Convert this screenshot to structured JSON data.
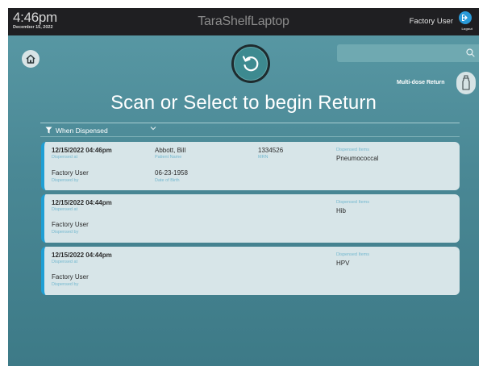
{
  "header": {
    "time": "4:46pm",
    "date": "December 15, 2022",
    "app_name": "TaraShelfLaptop",
    "user": "Factory User",
    "logout_label": "Logout"
  },
  "main": {
    "title": "Scan or Select to begin Return",
    "multidose_label": "Multi-dose Return",
    "search_placeholder": ""
  },
  "filter": {
    "label": "When Dispensed"
  },
  "labels": {
    "dispensed_at": "Dispensed at",
    "dispensed_by": "Dispensed by",
    "patient_name": "Patient Name",
    "date_of_birth": "Date of Birth",
    "mrn": "MRN",
    "dispensed_items": "Dispensed Items"
  },
  "records": [
    {
      "dispensed_at": "12/15/2022  04:46pm",
      "dispensed_by": "Factory User",
      "patient_name": "Abbott, Bill",
      "date_of_birth": "06-23-1958",
      "mrn": "1334526",
      "items": "Pneumococcal"
    },
    {
      "dispensed_at": "12/15/2022  04:44pm",
      "dispensed_by": "Factory User",
      "items": "Hib"
    },
    {
      "dispensed_at": "12/15/2022  04:44pm",
      "dispensed_by": "Factory User",
      "items": "HPV"
    }
  ],
  "colors": {
    "accent": "#1f9fd4",
    "background_top": "#5a9aa6",
    "card": "#d7e5e8",
    "topbar": "#1f1f22"
  }
}
